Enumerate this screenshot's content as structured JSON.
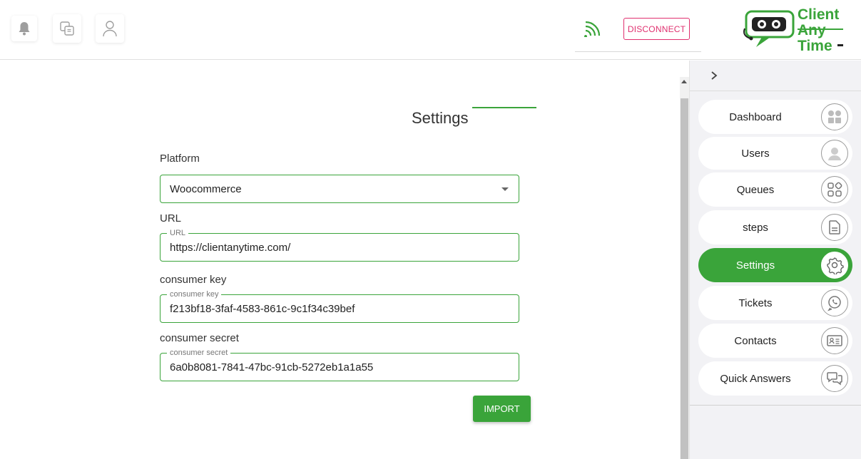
{
  "header": {
    "disconnect_label": "DISCONNECT",
    "logo_lines": [
      "Client",
      "Any",
      "Time"
    ]
  },
  "settings": {
    "title": "Settings",
    "platform": {
      "label": "Platform",
      "value": "Woocommerce"
    },
    "url": {
      "label": "URL",
      "legend": "URL",
      "value": "https://clientanytime.com/"
    },
    "consumer_key": {
      "label": "consumer key",
      "legend": "consumer key",
      "value": "f213bf18-3faf-4583-861c-9c1f34c39bef"
    },
    "consumer_secret": {
      "label": "consumer secret",
      "legend": "consumer secret",
      "value": "6a0b8081-7841-47bc-91cb-5272eb1a1a55"
    },
    "import_label": "IMPORT"
  },
  "sidebar": {
    "items": [
      {
        "label": "Dashboard",
        "icon": "dashboard-icon"
      },
      {
        "label": "Users",
        "icon": "user-icon"
      },
      {
        "label": "Queues",
        "icon": "queues-icon"
      },
      {
        "label": "steps",
        "icon": "document-icon"
      },
      {
        "label": "Settings",
        "icon": "gear-icon",
        "active": true
      },
      {
        "label": "Tickets",
        "icon": "phone-icon"
      },
      {
        "label": "Contacts",
        "icon": "contact-card-icon"
      },
      {
        "label": "Quick Answers",
        "icon": "chat-icon"
      }
    ]
  },
  "colors": {
    "accent": "#3aa43a",
    "disconnect": "#e0306f",
    "sidebar_bg": "#f2f2f5"
  }
}
